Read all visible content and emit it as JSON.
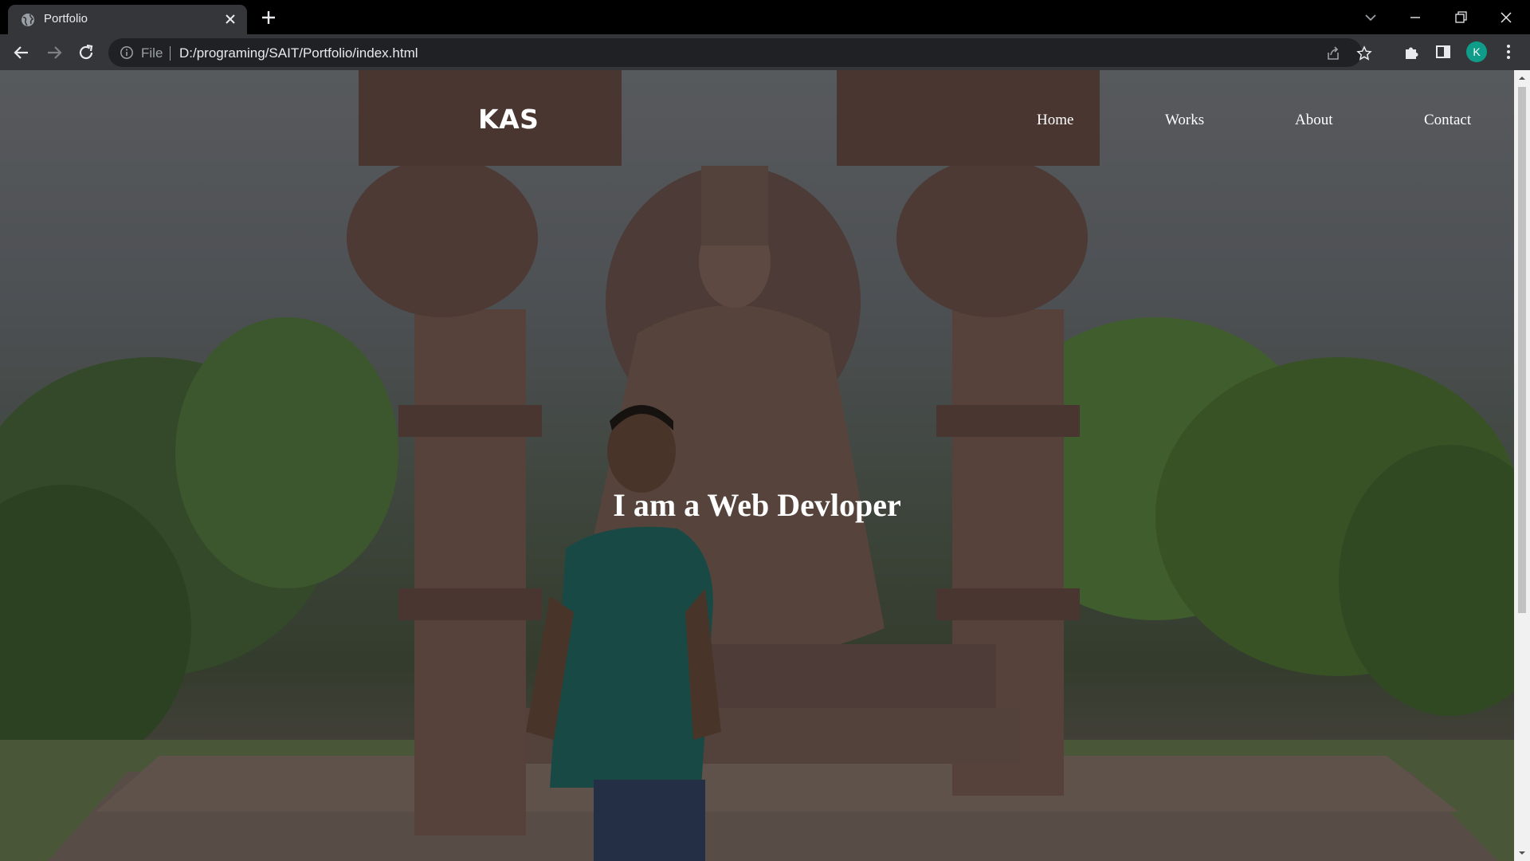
{
  "browser": {
    "tab": {
      "title": "Portfolio",
      "favicon": "globe-icon"
    },
    "address": {
      "scheme_label": "File",
      "url": "D:/programing/SAIT/Portfolio/index.html"
    },
    "profile": {
      "initial": "K",
      "color": "#0f9d8a"
    }
  },
  "page": {
    "brand": "KAS",
    "nav": {
      "home": "Home",
      "works": "Works",
      "about": "About",
      "contact": "Contact"
    },
    "headline": "I am a Web Devloper"
  }
}
